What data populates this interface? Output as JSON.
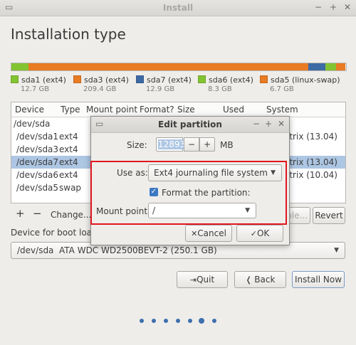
{
  "window": {
    "title": "Install"
  },
  "page": {
    "title": "Installation type"
  },
  "partition_bar": [
    {
      "name": "sda1 (ext4)",
      "size": "12.7 GB",
      "color": "#83c332",
      "fraction": 0.051
    },
    {
      "name": "sda3 (ext4)",
      "size": "209.4 GB",
      "color": "#e87b23",
      "fraction": 0.836
    },
    {
      "name": "sda7 (ext4)",
      "size": "12.9 GB",
      "color": "#3c6aa5",
      "fraction": 0.051
    },
    {
      "name": "sda6 (ext4)",
      "size": "8.3 GB",
      "color": "#83c332",
      "fraction": 0.033
    },
    {
      "name": "sda5 (linux-swap)",
      "size": "6.7 GB",
      "color": "#e87b23",
      "fraction": 0.027
    }
  ],
  "table": {
    "headers": [
      "Device",
      "Type",
      "Mount point",
      "Format?",
      "Size",
      "Used",
      "System"
    ],
    "rows": [
      {
        "device": "/dev/sda",
        "type": "",
        "system": ""
      },
      {
        "device": "/dev/sda1",
        "type": "ext4",
        "system": "atrix (13.04)"
      },
      {
        "device": "/dev/sda3",
        "type": "ext4",
        "system": ""
      },
      {
        "device": "/dev/sda7",
        "type": "ext4",
        "system": "atrix (13.04)"
      },
      {
        "device": "/dev/sda6",
        "type": "ext4",
        "system": "atrix (10.04)"
      },
      {
        "device": "/dev/sda5",
        "type": "swap",
        "system": ""
      }
    ],
    "selected_index": 3
  },
  "table_actions": {
    "add": "+",
    "remove": "−",
    "change": "Change...",
    "new_table": "able...",
    "revert": "Revert"
  },
  "boot_loader": {
    "label": "Device for boot loade",
    "device": "/dev/sda",
    "description": "ATA WDC WD2500BEVT-2 (250.1 GB)"
  },
  "buttons": {
    "quit": "Quit",
    "back": "Back",
    "install": "Install Now"
  },
  "dialog": {
    "title": "Edit partition",
    "size_label": "Size:",
    "size_value": "12893",
    "size_minus": "−",
    "size_plus": "+",
    "size_unit": "MB",
    "use_as_label": "Use as:",
    "use_as_value": "Ext4 journaling file system",
    "format_label": "Format the partition:",
    "format_checked": true,
    "mount_label": "Mount point:",
    "mount_value": "/",
    "cancel": "Cancel",
    "ok": "OK"
  },
  "pager": {
    "total": 7,
    "current": 6
  },
  "colors": {
    "accent": "#3d79c3",
    "highlight": "#e0171d"
  }
}
